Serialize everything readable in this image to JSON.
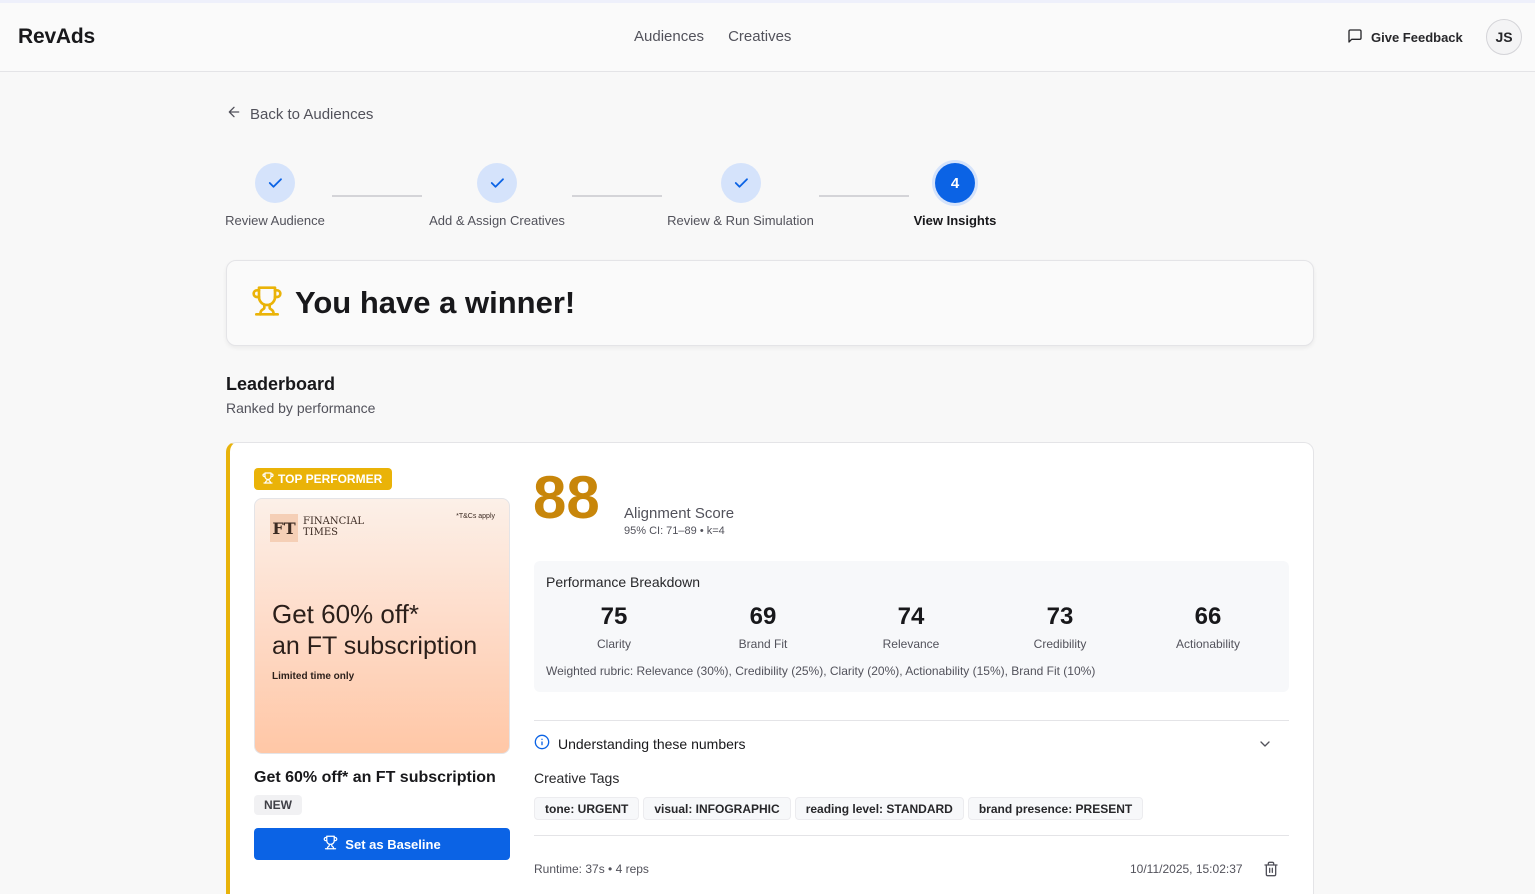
{
  "app": {
    "brand": "RevAds"
  },
  "nav": {
    "items": [
      "Audiences",
      "Creatives"
    ]
  },
  "header": {
    "feedback_label": "Give Feedback",
    "avatar_initials": "JS"
  },
  "back": {
    "label": "Back to Audiences"
  },
  "steps": [
    {
      "label": "Review Audience",
      "status": "complete"
    },
    {
      "label": "Add & Assign Creatives",
      "status": "complete"
    },
    {
      "label": "Review & Run Simulation",
      "status": "complete"
    },
    {
      "label": "View Insights",
      "number": "4",
      "status": "active"
    }
  ],
  "winner": {
    "title": "You have a winner!",
    "icon": "trophy-icon"
  },
  "leaderboard": {
    "title": "Leaderboard",
    "subtitle": "Ranked by performance"
  },
  "entry": {
    "badge": "TOP PERFORMER",
    "creative_image": {
      "logo_mark": "FT",
      "logo_line1": "FINANCIAL",
      "logo_line2": "TIMES",
      "fineprint": "*T&Cs apply",
      "headline1": "Get 60% off*",
      "headline2": "an FT subscription",
      "tagline": "Limited time only"
    },
    "title": "Get 60% off* an FT subscription",
    "status_badge": "NEW",
    "baseline_button": "Set as Baseline",
    "score": "88",
    "score_label": "Alignment Score",
    "score_ci": "95% CI: 71–89 • k=4",
    "breakdown": {
      "title": "Performance Breakdown",
      "metrics": [
        {
          "value": "75",
          "label": "Clarity"
        },
        {
          "value": "69",
          "label": "Brand Fit"
        },
        {
          "value": "74",
          "label": "Relevance"
        },
        {
          "value": "73",
          "label": "Credibility"
        },
        {
          "value": "66",
          "label": "Actionability"
        }
      ],
      "rubric": "Weighted rubric: Relevance (30%), Credibility (25%), Clarity (20%), Actionability (15%), Brand Fit (10%)"
    },
    "understanding_label": "Understanding these numbers",
    "tags_title": "Creative Tags",
    "tags": [
      "tone: URGENT",
      "visual: INFOGRAPHIC",
      "reading level: STANDARD",
      "brand presence: PRESENT"
    ],
    "runtime": "Runtime: 37s • 4 reps",
    "timestamp": "10/11/2025, 15:02:37"
  },
  "colors": {
    "accent": "#0b63e5",
    "gold": "#eab308",
    "score": "#c8860a"
  }
}
